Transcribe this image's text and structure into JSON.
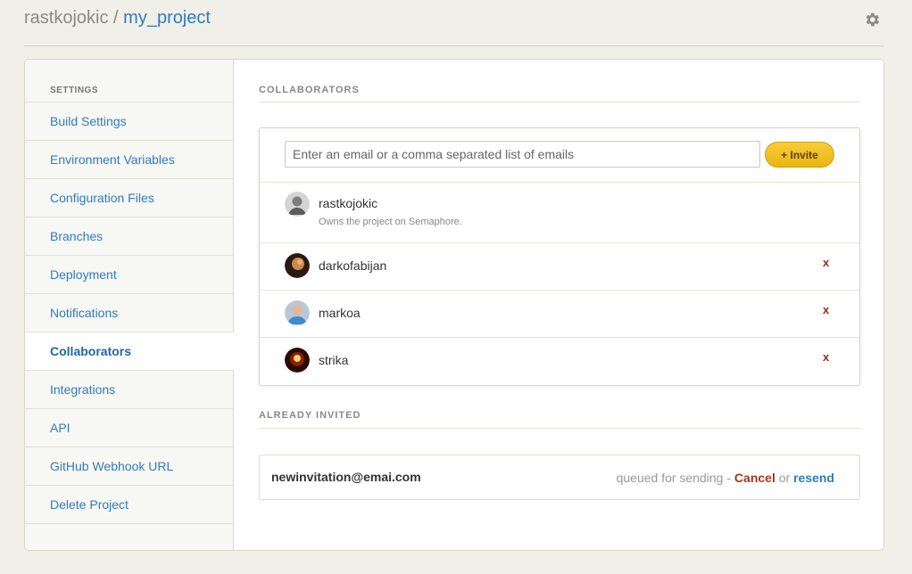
{
  "header": {
    "owner": "rastkojokic",
    "separator": " / ",
    "project": "my_project",
    "settings_icon": "gear-icon"
  },
  "sidebar": {
    "title": "SETTINGS",
    "items": [
      {
        "label": "Build Settings"
      },
      {
        "label": "Environment Variables"
      },
      {
        "label": "Configuration Files"
      },
      {
        "label": "Branches"
      },
      {
        "label": "Deployment"
      },
      {
        "label": "Notifications"
      },
      {
        "label": "Collaborators",
        "active": true
      },
      {
        "label": "Integrations"
      },
      {
        "label": "API"
      },
      {
        "label": "GitHub Webhook URL"
      },
      {
        "label": "Delete Project"
      }
    ]
  },
  "collaborators": {
    "title": "COLLABORATORS",
    "input_placeholder": "Enter an email or a comma separated list of emails",
    "invite_label": "+ Invite",
    "owner": {
      "name": "rastkojokic",
      "note": "Owns the project on Semaphore."
    },
    "members": [
      {
        "name": "darkofabijan",
        "remove_label": "x"
      },
      {
        "name": "markoa",
        "remove_label": "x"
      },
      {
        "name": "strika",
        "remove_label": "x"
      }
    ]
  },
  "invited": {
    "title": "ALREADY INVITED",
    "email": "newinvitation@emai.com",
    "status": "queued for sending - ",
    "cancel_label": "Cancel",
    "or": " or ",
    "resend_label": "resend"
  },
  "colors": {
    "link": "#2f7bbf",
    "invite_button": "#f0c12a",
    "remove": "#9b2a1b"
  }
}
